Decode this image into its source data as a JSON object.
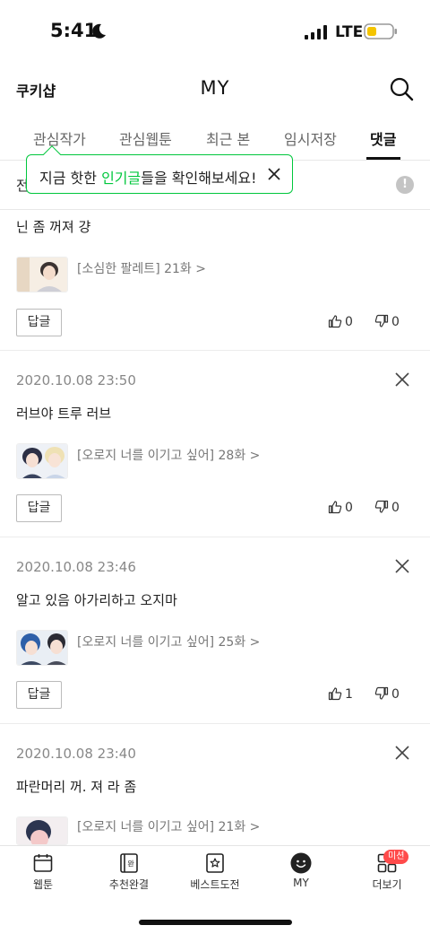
{
  "status_bar": {
    "time": "5:41",
    "network": "LTE"
  },
  "header": {
    "brand": "쿠키샵",
    "title": "MY"
  },
  "tabs": [
    {
      "label": "관심작가"
    },
    {
      "label": "관심웹툰"
    },
    {
      "label": "최근 본"
    },
    {
      "label": "임시저장"
    },
    {
      "label": "댓글",
      "active": true
    }
  ],
  "filter": {
    "label": "전"
  },
  "tooltip": {
    "prefix": "지금 핫한 ",
    "highlight": "인기글",
    "suffix": "들을 확인해보세요!"
  },
  "comments": [
    {
      "date": "",
      "text": "닌 좀 꺼져 걍",
      "episode": "[소심한 팔레트] 21화 >",
      "reply_label": "답글",
      "likes": "0",
      "dislikes": "0"
    },
    {
      "date": "2020.10.08 23:50",
      "text": "러브야 트루 러브",
      "episode": "[오로지 너를 이기고 싶어] 28화 >",
      "reply_label": "답글",
      "likes": "0",
      "dislikes": "0"
    },
    {
      "date": "2020.10.08 23:46",
      "text": "알고 있음 아가리하고 오지마",
      "episode": "[오로지 너를 이기고 싶어] 25화 >",
      "reply_label": "답글",
      "likes": "1",
      "dislikes": "0"
    },
    {
      "date": "2020.10.08 23:40",
      "text": "파란머리 꺼. 져 라 좀",
      "episode": "[오로지 너를 이기고 싶어] 21화 >",
      "reply_label": "",
      "likes": "",
      "dislikes": ""
    }
  ],
  "bottom_nav": [
    {
      "label": "웹툰",
      "icon": "calendar-icon"
    },
    {
      "label": "추천완결",
      "icon": "book-complete-icon"
    },
    {
      "label": "베스트도전",
      "icon": "star-box-icon"
    },
    {
      "label": "MY",
      "icon": "smiley-icon",
      "active": true
    },
    {
      "label": "더보기",
      "icon": "grid-icon",
      "badge": "미션"
    }
  ],
  "colors": {
    "accent": "#00c73c",
    "badge": "#ff4b4b",
    "text": "#222222",
    "muted": "#888888"
  }
}
